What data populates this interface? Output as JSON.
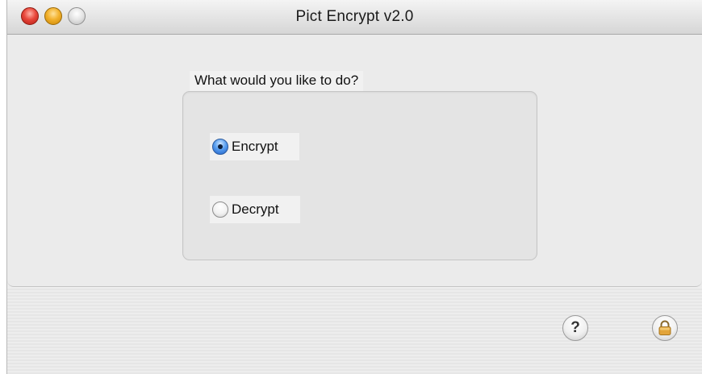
{
  "window": {
    "title": "Pict Encrypt v2.0"
  },
  "group": {
    "label": "What would you like to do?"
  },
  "options": [
    {
      "label": "Encrypt",
      "selected": true
    },
    {
      "label": "Decrypt",
      "selected": false
    }
  ],
  "footer": {
    "help_icon": "question-mark",
    "help_glyph": "?",
    "lock_icon": "padlock"
  },
  "colors": {
    "close": "#e8473b",
    "minimize": "#f2b12c",
    "radio_selected": "#3b82e0",
    "lock": "#e2a43a"
  }
}
